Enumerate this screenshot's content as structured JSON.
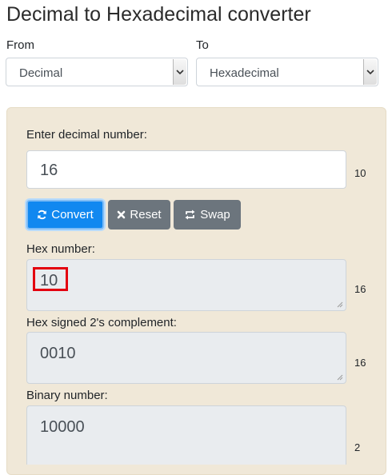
{
  "page": {
    "title": "Decimal to Hexadecimal converter"
  },
  "from": {
    "label": "From",
    "selected": "Decimal"
  },
  "to": {
    "label": "To",
    "selected": "Hexadecimal"
  },
  "input": {
    "label": "Enter decimal number:",
    "value": "16",
    "base": "10"
  },
  "buttons": {
    "convert": "Convert",
    "reset": "Reset",
    "swap": "Swap"
  },
  "outputs": {
    "hex": {
      "label": "Hex number:",
      "value": "10",
      "base": "16"
    },
    "hex_2s": {
      "label": "Hex signed 2's complement:",
      "value": "0010",
      "base": "16"
    },
    "binary": {
      "label": "Binary number:",
      "value": "10000",
      "base": "2"
    }
  },
  "icons": {
    "convert": "refresh-icon",
    "reset": "close-icon",
    "swap": "swap-icon",
    "select": "chevron-down-icon"
  },
  "colors": {
    "primary": "#1188f0",
    "secondary": "#6c757d",
    "panel": "#f0e8d8",
    "highlight": "#e3000f"
  }
}
